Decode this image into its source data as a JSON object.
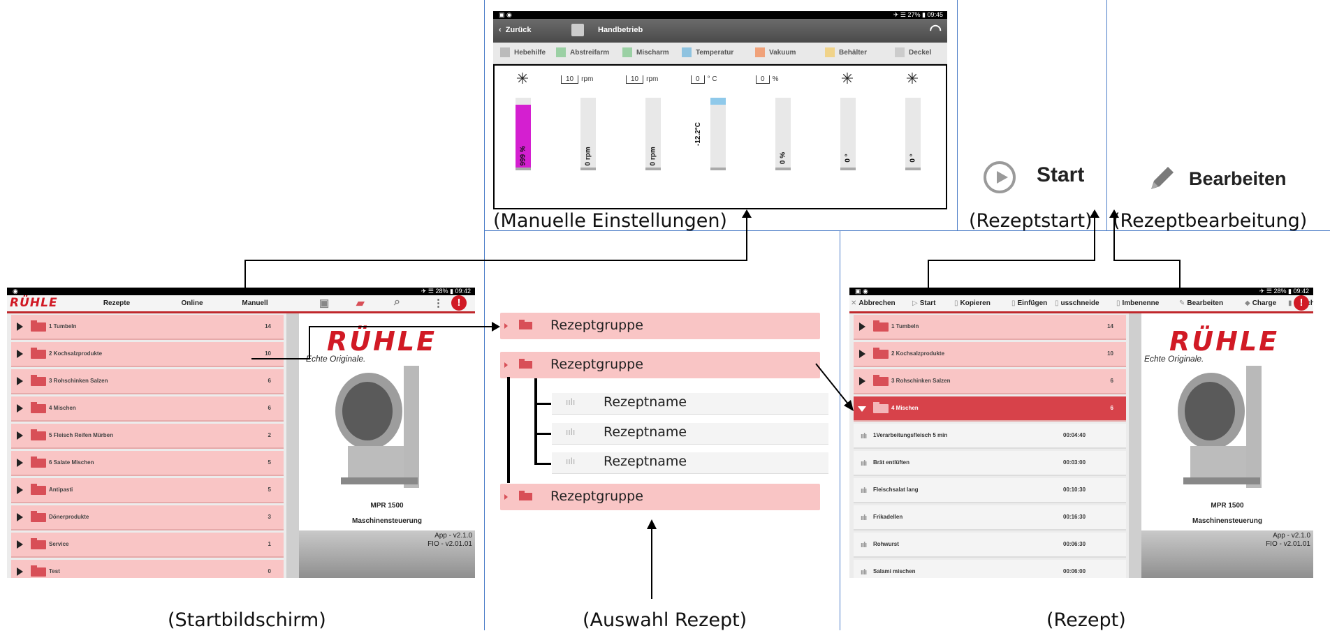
{
  "captions": {
    "manual": "(Manuelle Einstellungen)",
    "start": "(Rezeptstart)",
    "edit": "(Rezeptbearbeitung)",
    "home": "(Startbildschirm)",
    "select": "(Auswahl Rezept)",
    "recipe": "(Rezept)"
  },
  "manual": {
    "status_right": "✈ ☰ 27% ▮ 09:45",
    "back_label": "Zurück",
    "title": "Handbetrieb",
    "tabs": [
      "Hebehilfe",
      "Abstreifarm",
      "Mischarm",
      "Temperatur",
      "Vakuum",
      "Behälter",
      "Deckel"
    ],
    "columns": [
      {
        "setpoint": "",
        "unit": "",
        "bar_label": "999 %",
        "fill_pct": 90,
        "fill_color": "#d41fd0"
      },
      {
        "setpoint": "10",
        "unit": "rpm",
        "bar_label": "0 rpm",
        "fill_pct": 0,
        "fill_color": "#e8e8e8"
      },
      {
        "setpoint": "10",
        "unit": "rpm",
        "bar_label": "0 rpm",
        "fill_pct": 0,
        "fill_color": "#e8e8e8"
      },
      {
        "setpoint": "0",
        "unit": "° C",
        "bar_label": "-12.2°C",
        "fill_pct": 0,
        "fill_color": "#e8e8e8"
      },
      {
        "setpoint": "0",
        "unit": "%",
        "bar_label": "0 %",
        "fill_pct": 0,
        "fill_color": "#e8e8e8"
      },
      {
        "setpoint": "",
        "unit": "",
        "bar_label": "0 °",
        "fill_pct": 0,
        "fill_color": "#e8e8e8"
      },
      {
        "setpoint": "",
        "unit": "",
        "bar_label": "0 °",
        "fill_pct": 0,
        "fill_color": "#e8e8e8"
      }
    ]
  },
  "start_button": {
    "label": "Start"
  },
  "edit_button": {
    "label": "Bearbeiten"
  },
  "home": {
    "status_right": "✈ ☰ 28% ▮ 09:42",
    "logo": "RÜHLE",
    "tabs": [
      "Rezepte",
      "Online",
      "Manuell"
    ],
    "groups": [
      {
        "name": "1 Tumbeln",
        "count": "14"
      },
      {
        "name": "2 Kochsalzprodukte",
        "count": "10"
      },
      {
        "name": "3 Rohschinken Salzen",
        "count": "6"
      },
      {
        "name": "4 Mischen",
        "count": "6"
      },
      {
        "name": "5 Fleisch Reifen Mürben",
        "count": "2"
      },
      {
        "name": "6 Salate Mischen",
        "count": "5"
      },
      {
        "name": "Antipasti",
        "count": "5"
      },
      {
        "name": "Dönerprodukte",
        "count": "3"
      },
      {
        "name": "Service",
        "count": "1"
      },
      {
        "name": "Test",
        "count": "0"
      }
    ],
    "tagline": "Echte Originale.",
    "model": "MPR 1500",
    "subtitle": "Maschinensteuerung",
    "version_app": "App - v2.1.0",
    "version_fio": "FIO - v2.01.01"
  },
  "select": {
    "group_label": "Rezeptgruppe",
    "recipe_label": "Rezeptname"
  },
  "recipe": {
    "status_right": "✈ ☰ 28% ▮ 09:42",
    "toolbar": [
      "Abbrechen",
      "Start",
      "Kopieren",
      "Einfügen",
      "usschneide",
      "Imbenenne",
      "Bearbeiten",
      "Charge",
      "Löschen"
    ],
    "groups": [
      {
        "name": "1 Tumbeln",
        "count": "14"
      },
      {
        "name": "2 Kochsalzprodukte",
        "count": "10"
      },
      {
        "name": "3 Rohschinken Salzen",
        "count": "6"
      },
      {
        "name": "4 Mischen",
        "count": "6"
      }
    ],
    "recipes": [
      {
        "name": "1Verarbeitungsfleisch 5 min",
        "time": "00:04:40"
      },
      {
        "name": "Brät entlüften",
        "time": "00:03:00"
      },
      {
        "name": "Fleischsalat lang",
        "time": "00:10:30"
      },
      {
        "name": "Frikadellen",
        "time": "00:16:30"
      },
      {
        "name": "Rohwurst",
        "time": "00:06:30"
      },
      {
        "name": "Salami mischen",
        "time": "00:06:00"
      }
    ],
    "logo": "RÜHLE",
    "tagline": "Echte Originale.",
    "model": "MPR 1500",
    "subtitle": "Maschinensteuerung",
    "version_app": "App - v2.1.0",
    "version_fio": "FIO - v2.01.01"
  }
}
